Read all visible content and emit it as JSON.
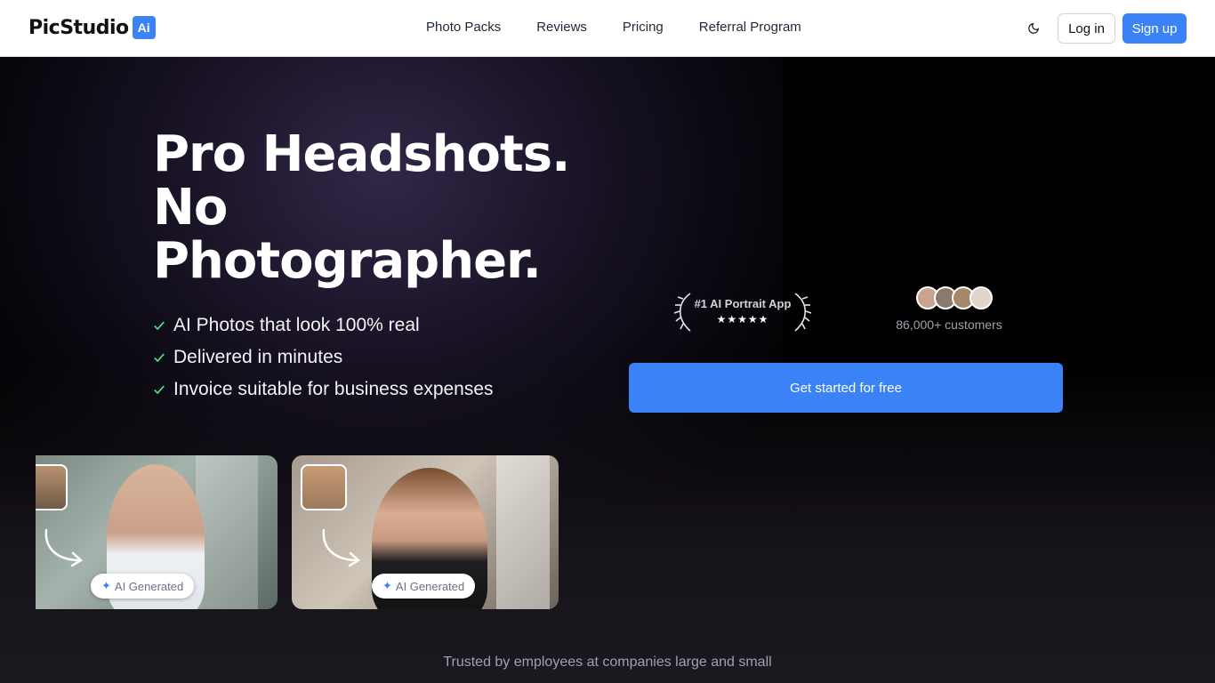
{
  "header": {
    "logo_text": "PicStudio",
    "logo_badge": "Ai",
    "nav": [
      "Photo Packs",
      "Reviews",
      "Pricing",
      "Referral Program"
    ],
    "theme_icon": "moon-icon",
    "login_label": "Log in",
    "signup_label": "Sign up"
  },
  "hero": {
    "headline_line1": "Pro Headshots.",
    "headline_line2": "No",
    "headline_line3": "Photographer.",
    "features": [
      "AI Photos that look 100% real",
      "Delivered in minutes",
      "Invoice suitable for business expenses"
    ],
    "award_title": "#1 AI Portrait App",
    "award_stars": "★★★★★",
    "customers": "86,000+ customers",
    "cta_label": "Get started for free",
    "cards": [
      {
        "badge": "AI Generated"
      },
      {
        "badge": "AI Generated"
      }
    ],
    "trusted": "Trusted by employees at companies large and small"
  },
  "colors": {
    "brand": "#3b82f6",
    "hero_bg": "#000000",
    "check": "#4ade80"
  }
}
